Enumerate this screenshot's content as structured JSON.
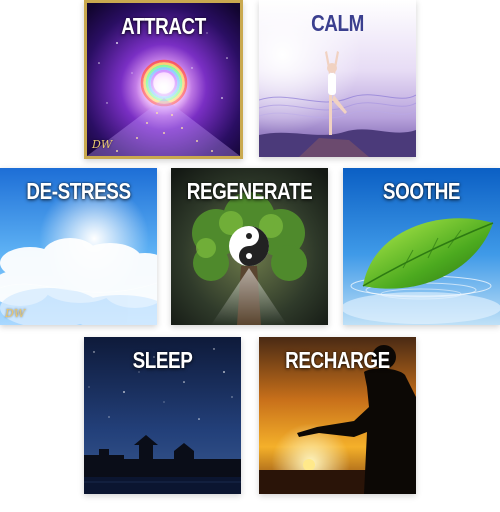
{
  "tiles": {
    "attract": {
      "label": "ATTRACT",
      "logo": "DW"
    },
    "calm": {
      "label": "CALM"
    },
    "destress": {
      "label": "DE-STRESS",
      "logo": "DW"
    },
    "regenerate": {
      "label": "REGENERATE"
    },
    "soothe": {
      "label": "SOOTHE"
    },
    "sleep": {
      "label": "SLEEP"
    },
    "recharge": {
      "label": "RECHARGE"
    }
  },
  "colors": {
    "attract_frame": "#c9a94f",
    "calm_label": "#3b3f8f",
    "label_default": "#ffffff"
  }
}
